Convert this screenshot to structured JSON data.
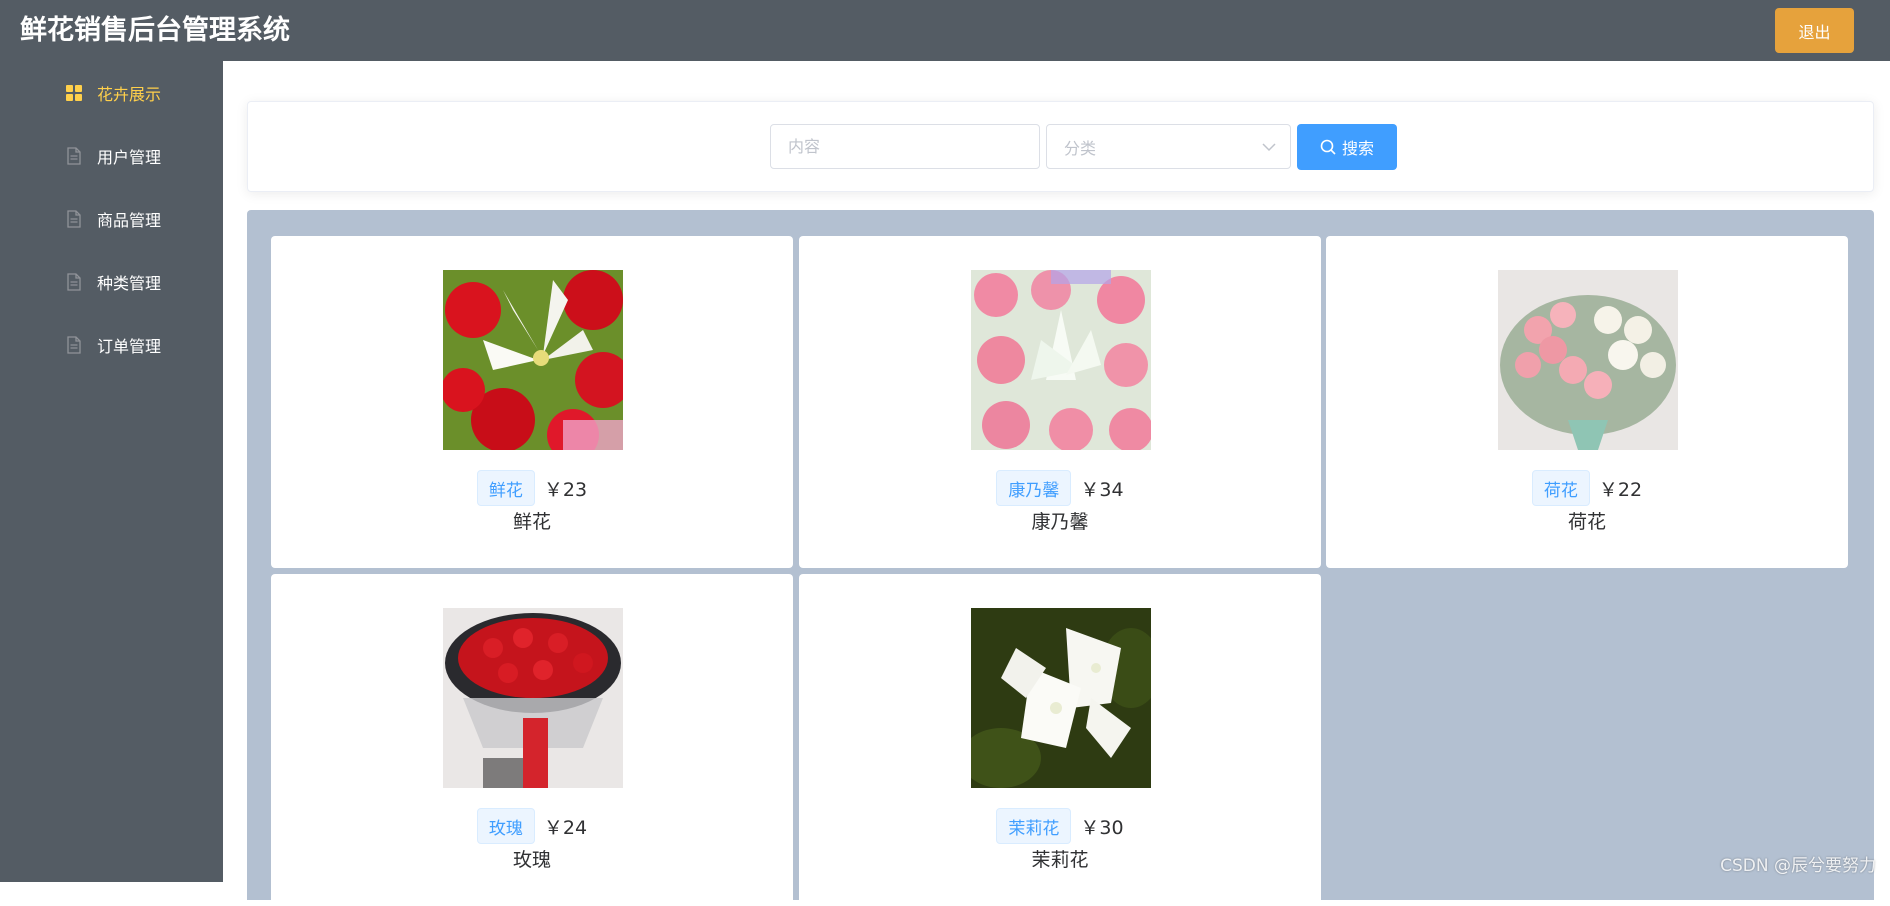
{
  "header": {
    "title": "鲜花销售后台管理系统",
    "logout_label": "退出"
  },
  "sidebar": {
    "items": [
      {
        "label": "花卉展示",
        "icon": "grid-icon",
        "active": true
      },
      {
        "label": "用户管理",
        "icon": "document-icon",
        "active": false
      },
      {
        "label": "商品管理",
        "icon": "document-icon",
        "active": false
      },
      {
        "label": "种类管理",
        "icon": "document-icon",
        "active": false
      },
      {
        "label": "订单管理",
        "icon": "document-icon",
        "active": false
      }
    ]
  },
  "search": {
    "content_placeholder": "内容",
    "category_placeholder": "分类",
    "button_label": "搜索"
  },
  "products": [
    {
      "tag": "鲜花",
      "price": "￥23",
      "name": "鲜花"
    },
    {
      "tag": "康乃馨",
      "price": "￥34",
      "name": "康乃馨"
    },
    {
      "tag": "荷花",
      "price": "￥22",
      "name": "荷花"
    },
    {
      "tag": "玫瑰",
      "price": "￥24",
      "name": "玫瑰"
    },
    {
      "tag": "茉莉花",
      "price": "￥30",
      "name": "茉莉花"
    }
  ],
  "watermark": "CSDN @辰兮要努力",
  "colors": {
    "header_bg": "#545c64",
    "active_menu": "#ffd04b",
    "primary": "#409eff",
    "warning": "#e6a23c",
    "grid_bg": "#b3c0d1"
  }
}
